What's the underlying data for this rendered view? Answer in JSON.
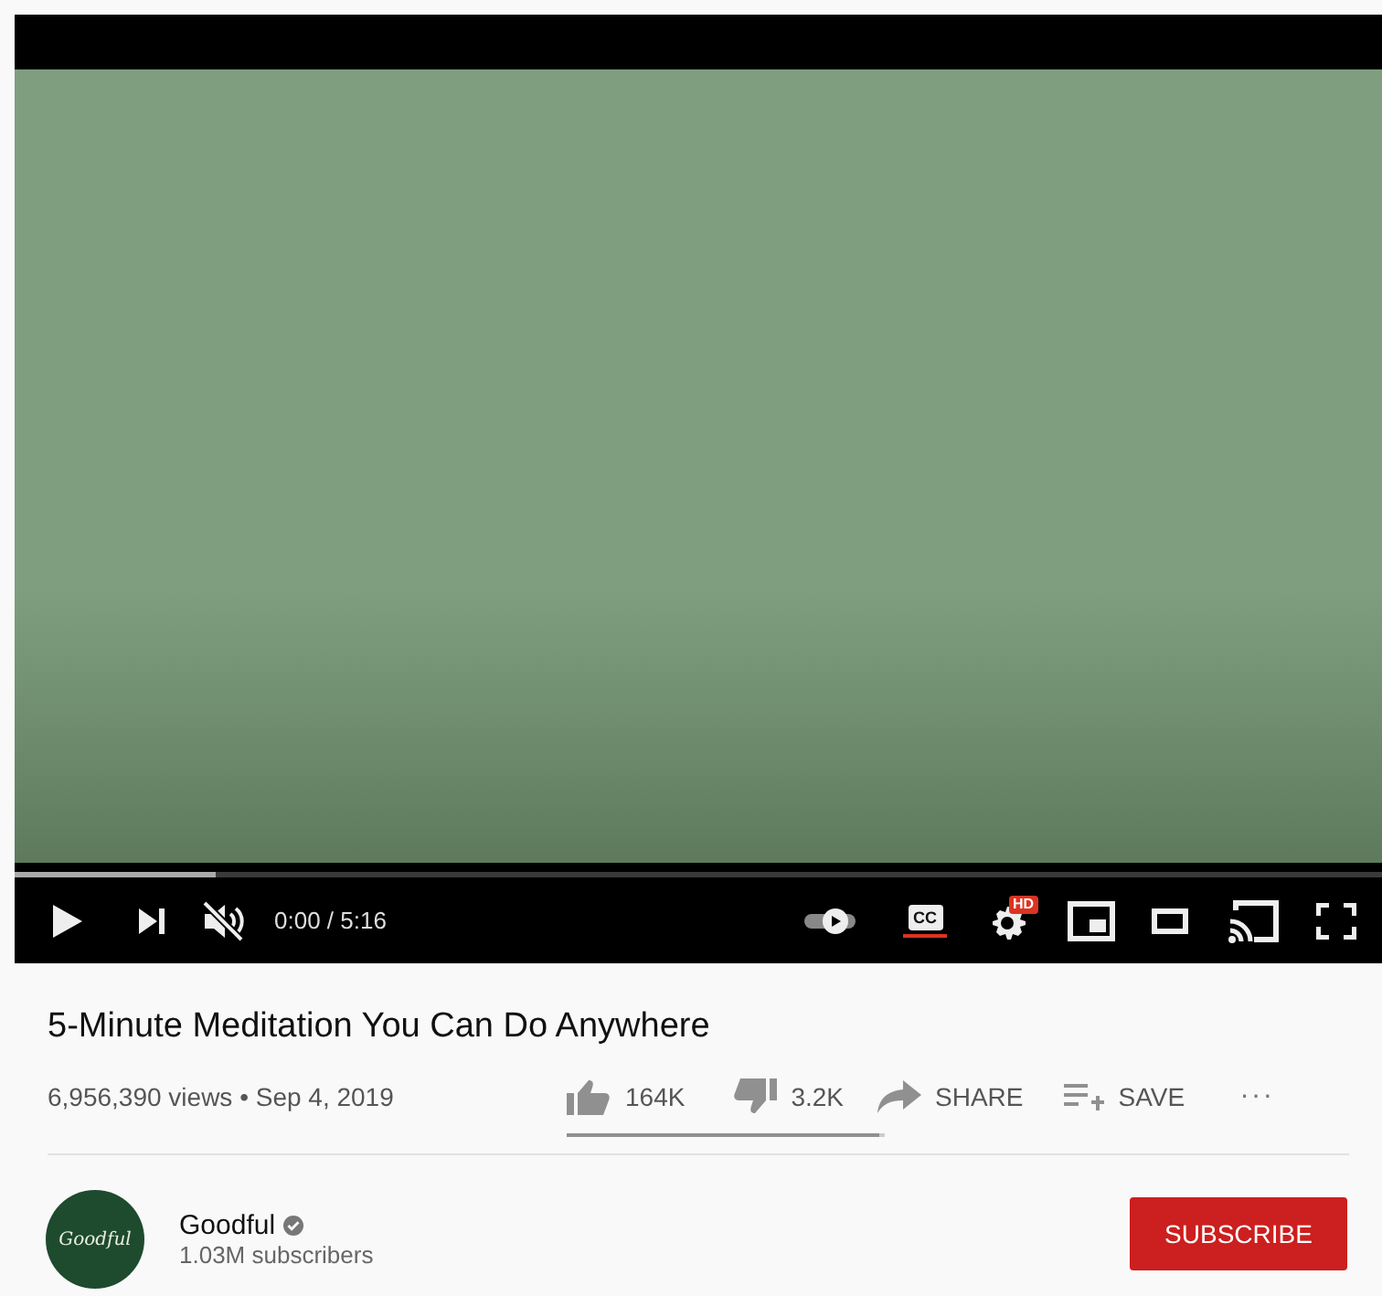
{
  "player": {
    "progress": {
      "level": 0.147
    },
    "muted": true,
    "time": "0:00 / 5:16",
    "autoplay": {
      "on": false
    },
    "captions": {
      "on": true,
      "label": "CC"
    },
    "quality_badge": "HD"
  },
  "video": {
    "title": "5-Minute Meditation You Can Do Anywhere",
    "stats": "6,956,390 views • Sep 4, 2019",
    "actions": [
      {
        "kind": "like",
        "label": "164K"
      },
      {
        "kind": "dislike",
        "label": "3.2K"
      },
      {
        "kind": "share",
        "label": "SHARE"
      },
      {
        "kind": "save",
        "label": "SAVE"
      },
      {
        "kind": "more",
        "label": "···"
      }
    ],
    "sentiment": {
      "level": 0.98
    }
  },
  "channel": {
    "avatar_text": "Goodful",
    "name": "Goodful",
    "verified": true,
    "subscribers": "1.03M subscribers",
    "subscribe": "SUBSCRIBE"
  }
}
